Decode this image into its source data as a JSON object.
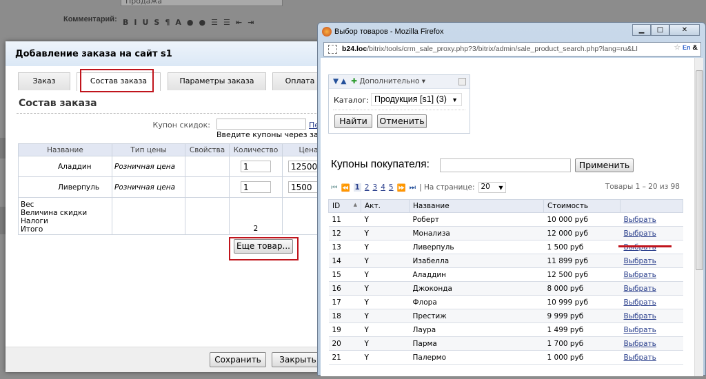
{
  "background": {
    "select_value": "Продажа",
    "comment_label": "Комментарий:",
    "toolbar": [
      "B",
      "I",
      "U",
      "S",
      "¶",
      "A",
      "●",
      "●",
      "☰",
      "☰",
      "⇤",
      "⇥"
    ]
  },
  "dialog": {
    "title": "Добавление заказа на сайт s1",
    "tabs": [
      {
        "label": "Заказ"
      },
      {
        "label": "Состав заказа",
        "active": true
      },
      {
        "label": "Параметры заказа"
      },
      {
        "label": "Оплата"
      }
    ],
    "section_title": "Состав заказа",
    "coupon_label": "Купон скидок:",
    "coupon_value": "",
    "coupon_link": "Пе",
    "coupon_hint": "Введите купоны через зап",
    "columns": [
      "Название",
      "Тип цены",
      "Свойства",
      "Количество",
      "Цена"
    ],
    "rows": [
      {
        "name": "Аладдин",
        "price_type": "Розничная цена",
        "qty": "1",
        "price": "12500"
      },
      {
        "name": "Ливерпуль",
        "price_type": "Розничная цена",
        "qty": "1",
        "price": "1500"
      }
    ],
    "totals": {
      "labels": [
        "Вес",
        "Величина скидки",
        "Налоги",
        "Итого"
      ],
      "qty_total": "2"
    },
    "more_button": "Еще товар...",
    "save_button": "Сохранить",
    "close_button": "Закрыть",
    "highlight_color": "#c0141c"
  },
  "firefox": {
    "title": "Выбор товаров - Mozilla Firefox",
    "url_host": "b24.loc",
    "url_path": "/bitrix/tools/crm_sale_proxy.php?3/bitrix/admin/sale_product_search.php?lang=ru&LI",
    "filter": {
      "more_label": "Дополнительно",
      "catalog_label": "Каталог:",
      "catalog_value": "Продукция [s1] (3)",
      "find_button": "Найти",
      "cancel_button": "Отменить"
    },
    "coupons_label": "Купоны покупателя:",
    "coupons_value": "",
    "apply_button": "Применить",
    "pager": {
      "pages": [
        "1",
        "2",
        "3",
        "4",
        "5"
      ],
      "current": "1",
      "per_page_label": "| На странице:",
      "per_page": "20",
      "summary": "Товары 1 – 20 из 98"
    },
    "columns": [
      "ID",
      "Акт.",
      "Название",
      "Стоимость",
      ""
    ],
    "rows": [
      [
        "11",
        "Y",
        "Роберт",
        "10 000 руб"
      ],
      [
        "12",
        "Y",
        "Монализа",
        "12 000 руб"
      ],
      [
        "13",
        "Y",
        "Ливерпуль",
        "1 500 руб"
      ],
      [
        "14",
        "Y",
        "Изабелла",
        "11 899 руб"
      ],
      [
        "15",
        "Y",
        "Аладдин",
        "12 500 руб"
      ],
      [
        "16",
        "Y",
        "Джоконда",
        "8 000 руб"
      ],
      [
        "17",
        "Y",
        "Флора",
        "10 999 руб"
      ],
      [
        "18",
        "Y",
        "Престиж",
        "9 999 руб"
      ],
      [
        "19",
        "Y",
        "Лаура",
        "1 499 руб"
      ],
      [
        "20",
        "Y",
        "Парма",
        "1 700 руб"
      ],
      [
        "21",
        "Y",
        "Палермо",
        "1 000 руб"
      ]
    ],
    "select_link": "Выбрать"
  }
}
